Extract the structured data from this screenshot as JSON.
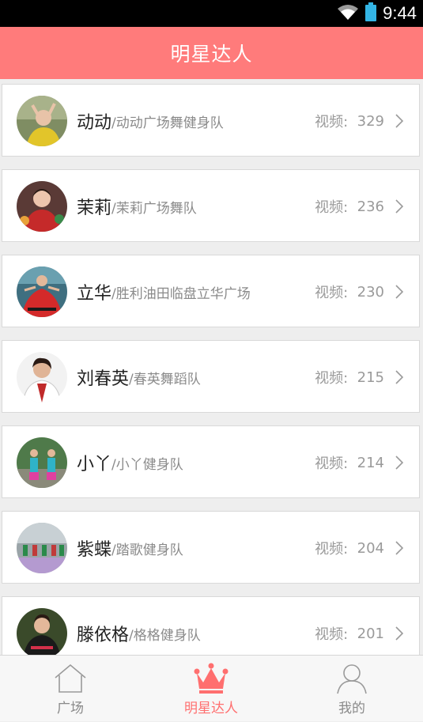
{
  "status_bar": {
    "time": "9:44"
  },
  "header": {
    "title": "明星达人"
  },
  "list_items": [
    {
      "name": "动动",
      "team": "/动动广场舞健身队",
      "videos_label": "视频:",
      "videos_count": "329"
    },
    {
      "name": "茉莉",
      "team": "/茉莉广场舞队",
      "videos_label": "视频:",
      "videos_count": "236"
    },
    {
      "name": "立华",
      "team": "/胜利油田临盘立华广场",
      "videos_label": "视频:",
      "videos_count": "230"
    },
    {
      "name": "刘春英",
      "team": "/春英舞蹈队",
      "videos_label": "视频:",
      "videos_count": "215"
    },
    {
      "name": "小丫",
      "team": "/小丫健身队",
      "videos_label": "视频:",
      "videos_count": "214"
    },
    {
      "name": "紫蝶",
      "team": "/踏歌健身队",
      "videos_label": "视频:",
      "videos_count": "204"
    },
    {
      "name": "滕依格",
      "team": "/格格健身队",
      "videos_label": "视频:",
      "videos_count": "201"
    }
  ],
  "tabbar": {
    "tabs": [
      {
        "label": "广场",
        "icon": "home-icon",
        "active": false
      },
      {
        "label": "明星达人",
        "icon": "crown-icon",
        "active": true
      },
      {
        "label": "我的",
        "icon": "person-icon",
        "active": false
      }
    ]
  },
  "colors": {
    "accent": "#ff7b7b",
    "tab_active": "#ff6f6f"
  }
}
